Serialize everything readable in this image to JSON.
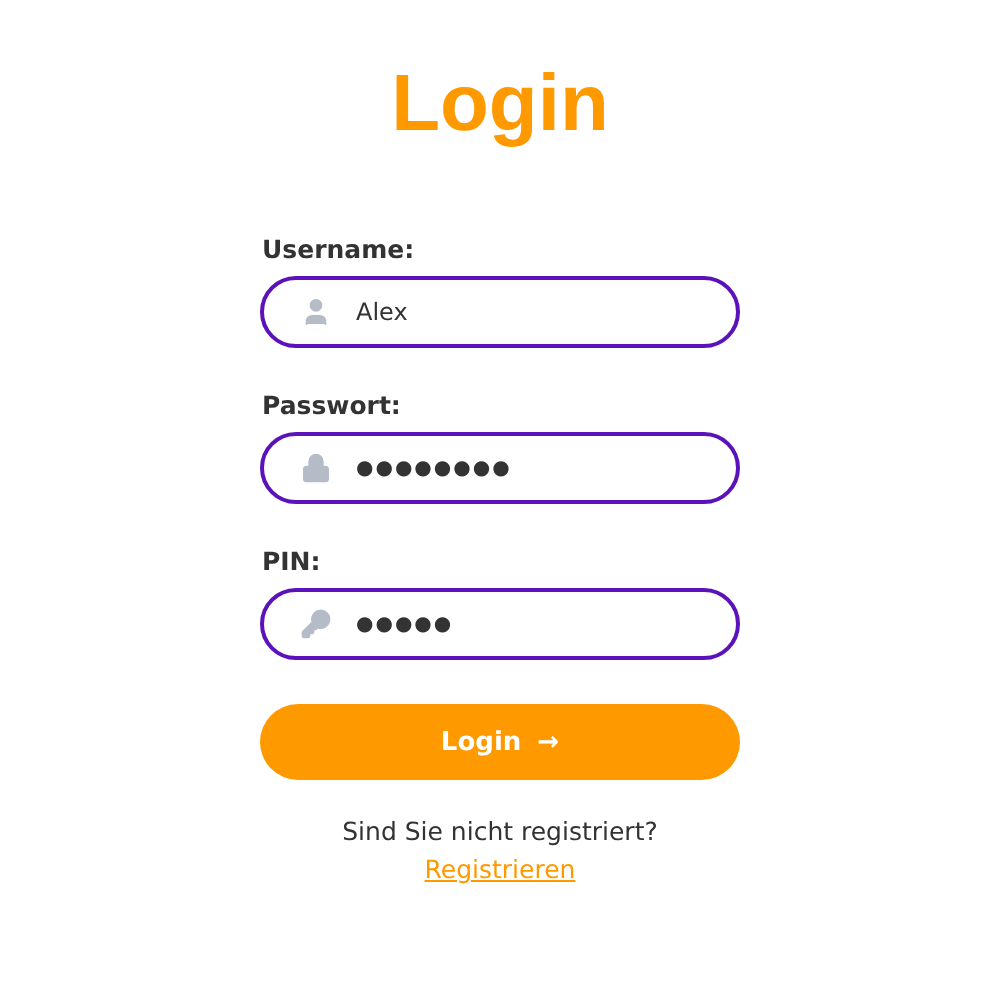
{
  "title": "Login",
  "fields": [
    {
      "label": "Username:",
      "kind": "user",
      "value": "Alex",
      "masked": false
    },
    {
      "label": "Passwort:",
      "kind": "lock",
      "value": "●●●●●●●●",
      "masked": true
    },
    {
      "label": "PIN:",
      "kind": "key",
      "value": "●●●●●",
      "masked": true
    }
  ],
  "button": {
    "label": "Login",
    "arrow": "→"
  },
  "prompt": "Sind Sie nicht registriert?",
  "link": "Registrieren"
}
